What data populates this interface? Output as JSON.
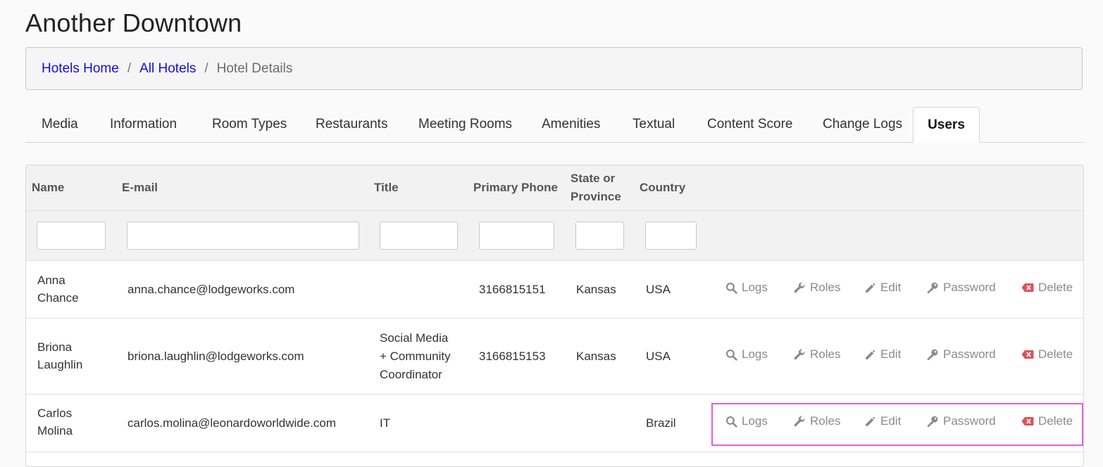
{
  "page": {
    "title": "Another Downtown"
  },
  "breadcrumb": {
    "items": [
      {
        "label": "Hotels Home"
      },
      {
        "label": "All Hotels"
      }
    ],
    "current": "Hotel Details",
    "separator": "/"
  },
  "tabs": [
    {
      "label": "Media"
    },
    {
      "label": "Information"
    },
    {
      "label": "Room Types"
    },
    {
      "label": "Restaurants"
    },
    {
      "label": "Meeting Rooms"
    },
    {
      "label": "Amenities"
    },
    {
      "label": "Textual"
    },
    {
      "label": "Content Score"
    },
    {
      "label": "Change Logs"
    },
    {
      "label": "Users",
      "active": true
    }
  ],
  "table": {
    "headers": {
      "name": "Name",
      "email": "E-mail",
      "title": "Title",
      "phone": "Primary Phone",
      "state_line1": "State or",
      "state_line2": "Province",
      "country": "Country"
    },
    "filters": {
      "name": "",
      "email": "",
      "title": "",
      "phone": "",
      "state": "",
      "country": ""
    },
    "action_labels": {
      "logs": "Logs",
      "roles": "Roles",
      "edit": "Edit",
      "password": "Password",
      "delete": "Delete"
    },
    "rows": [
      {
        "name_line1": "Anna",
        "name_line2": "Chance",
        "email": "anna.chance@lodgeworks.com",
        "title_line1": "",
        "title_line2": "",
        "title_line3": "",
        "phone": "3166815151",
        "state": "Kansas",
        "country": "USA"
      },
      {
        "name_line1": "Briona",
        "name_line2": "Laughlin",
        "email": "briona.laughlin@lodgeworks.com",
        "title_line1": "Social Media",
        "title_line2": "+ Community",
        "title_line3": "Coordinator",
        "phone": "3166815153",
        "state": "Kansas",
        "country": "USA"
      },
      {
        "name_line1": "Carlos",
        "name_line2": "Molina",
        "email": "carlos.molina@leonardoworldwide.com",
        "title_line1": "IT",
        "title_line2": "",
        "title_line3": "",
        "phone": "",
        "state": "",
        "country": "Brazil"
      }
    ]
  },
  "colors": {
    "link": "#1a0dcc",
    "action_gray": "#8a8a8a",
    "delete_red": "#e0505a",
    "highlight": "#e55be6"
  }
}
